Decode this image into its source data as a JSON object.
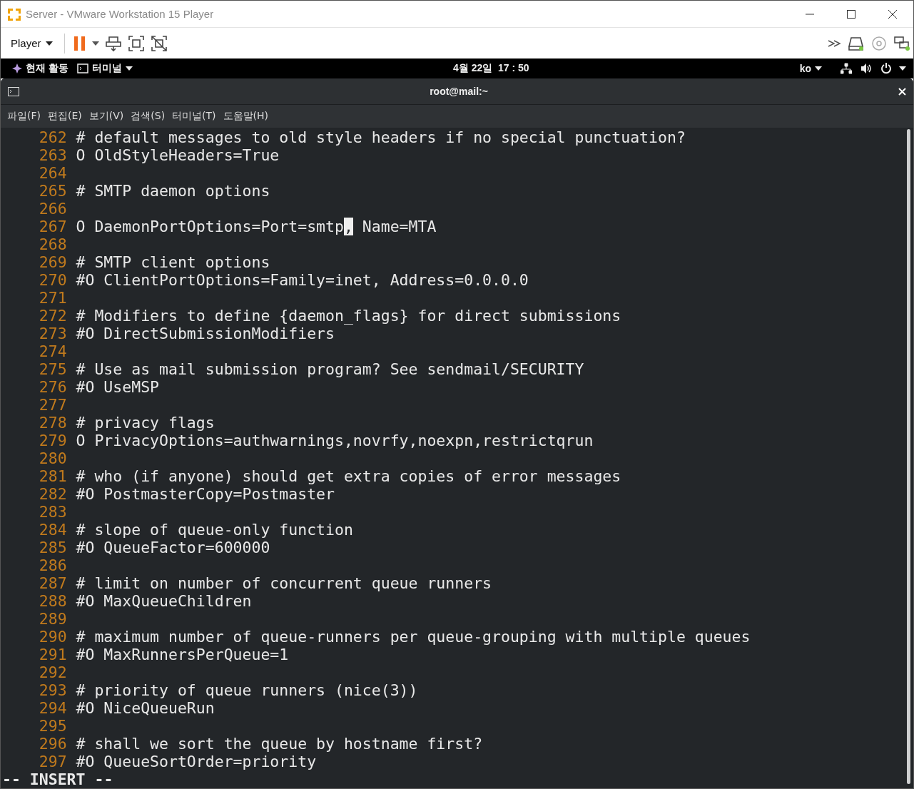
{
  "window": {
    "title": "Server - VMware Workstation 15 Player"
  },
  "toolbar": {
    "player_menu": "Player"
  },
  "top_bar": {
    "activities": "현재 활동",
    "app_menu": "터미널",
    "clock": "4월 22일  17 : 50",
    "input_method": "ko"
  },
  "terminal": {
    "title": "root@mail:~",
    "menu": [
      "파일(F)",
      "편집(E)",
      "보기(V)",
      "검색(S)",
      "터미널(T)",
      "도움말(H)"
    ],
    "lines": [
      {
        "number": "262",
        "text": "# default messages to old style headers if no special punctuation?"
      },
      {
        "number": "263",
        "text": "O OldStyleHeaders=True"
      },
      {
        "number": "264"
      },
      {
        "number": "265",
        "text": "# SMTP daemon options"
      },
      {
        "number": "266"
      },
      {
        "number": "267",
        "text": "O DaemonPortOptions=Port=smtp",
        "cursor_char": ",",
        "text_after": " Name=MTA"
      },
      {
        "number": "268"
      },
      {
        "number": "269",
        "text": "# SMTP client options"
      },
      {
        "number": "270",
        "text": "#O ClientPortOptions=Family=inet, Address=0.0.0.0"
      },
      {
        "number": "271"
      },
      {
        "number": "272",
        "text": "# Modifiers to define {daemon_flags} for direct submissions"
      },
      {
        "number": "273",
        "text": "#O DirectSubmissionModifiers"
      },
      {
        "number": "274"
      },
      {
        "number": "275",
        "text": "# Use as mail submission program? See sendmail/SECURITY"
      },
      {
        "number": "276",
        "text": "#O UseMSP"
      },
      {
        "number": "277"
      },
      {
        "number": "278",
        "text": "# privacy flags"
      },
      {
        "number": "279",
        "text": "O PrivacyOptions=authwarnings,novrfy,noexpn,restrictqrun"
      },
      {
        "number": "280"
      },
      {
        "number": "281",
        "text": "# who (if anyone) should get extra copies of error messages"
      },
      {
        "number": "282",
        "text": "#O PostmasterCopy=Postmaster"
      },
      {
        "number": "283"
      },
      {
        "number": "284",
        "text": "# slope of queue-only function"
      },
      {
        "number": "285",
        "text": "#O QueueFactor=600000"
      },
      {
        "number": "286"
      },
      {
        "number": "287",
        "text": "# limit on number of concurrent queue runners"
      },
      {
        "number": "288",
        "text": "#O MaxQueueChildren"
      },
      {
        "number": "289"
      },
      {
        "number": "290",
        "text": "# maximum number of queue-runners per queue-grouping with multiple queues"
      },
      {
        "number": "291",
        "text": "#O MaxRunnersPerQueue=1"
      },
      {
        "number": "292"
      },
      {
        "number": "293",
        "text": "# priority of queue runners (nice(3))"
      },
      {
        "number": "294",
        "text": "#O NiceQueueRun"
      },
      {
        "number": "295"
      },
      {
        "number": "296",
        "text": "# shall we sort the queue by hostname first?"
      },
      {
        "number": "297",
        "text": "#O QueueSortOrder=priority"
      }
    ],
    "mode": "-- INSERT --"
  }
}
